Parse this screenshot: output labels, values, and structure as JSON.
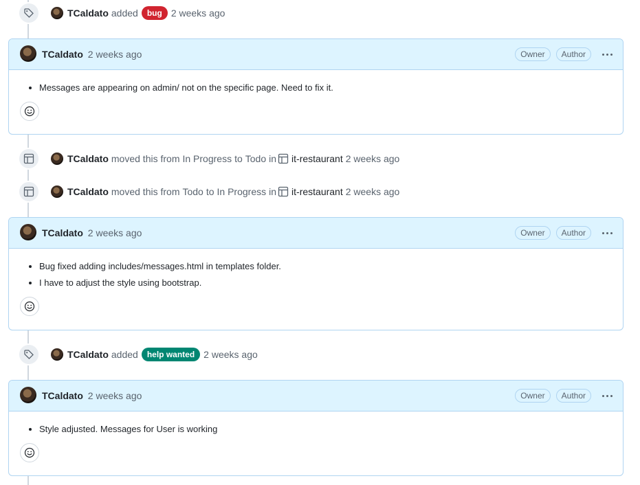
{
  "user": "TCaldato",
  "time": "2 weeks ago",
  "events": [
    {
      "verb": "added",
      "label": "bug",
      "label_color": "#d1242f",
      "time": "2 weeks ago"
    },
    {
      "verb": "moved this from",
      "from": "In Progress",
      "to_word": "to",
      "to": "Todo",
      "in_word": "in",
      "project": "it-restaurant",
      "time": "2 weeks ago"
    },
    {
      "verb": "moved this from",
      "from": "Todo",
      "to_word": "to",
      "to": "In Progress",
      "in_word": "in",
      "project": "it-restaurant",
      "time": "2 weeks ago"
    },
    {
      "verb": "added",
      "label": "help wanted",
      "label_color": "#008672",
      "time": "2 weeks ago"
    }
  ],
  "comments": [
    {
      "author": "TCaldato",
      "time": "2 weeks ago",
      "badges": [
        "Owner",
        "Author"
      ],
      "items": [
        "Messages are appearing on admin/ not on the specific page. Need to fix it."
      ]
    },
    {
      "author": "TCaldato",
      "time": "2 weeks ago",
      "badges": [
        "Owner",
        "Author"
      ],
      "items": [
        "Bug fixed adding includes/messages.html in templates folder.",
        "I have to adjust the style using bootstrap."
      ]
    },
    {
      "author": "TCaldato",
      "time": "2 weeks ago",
      "badges": [
        "Owner",
        "Author"
      ],
      "items": [
        "Style adjusted. Messages for User is working"
      ]
    }
  ],
  "colors": {
    "accent_bg": "#ddf4ff",
    "accent_border": "#afd4f1",
    "bug": "#d1242f",
    "help_wanted": "#008672"
  },
  "icons": {
    "label_event": "tag-icon",
    "project_event": "table-icon",
    "reaction": "smiley-icon",
    "menu": "kebab-horizontal-icon"
  }
}
